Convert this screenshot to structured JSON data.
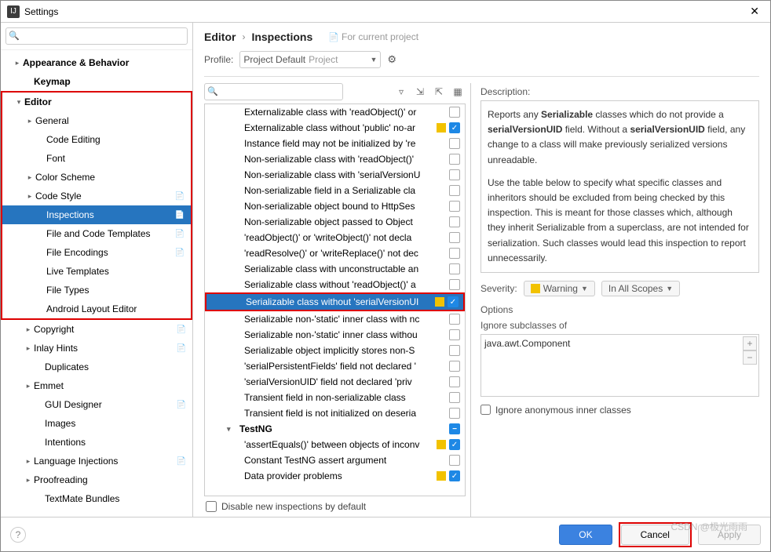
{
  "window": {
    "title": "Settings"
  },
  "sidebar_search": {
    "placeholder": ""
  },
  "tree": [
    {
      "label": "Appearance & Behavior",
      "indent": 14,
      "arrow": "▸",
      "bold": true
    },
    {
      "label": "Keymap",
      "indent": 28,
      "arrow": "",
      "bold": true
    },
    {
      "label": "Editor",
      "indent": 14,
      "arrow": "▾",
      "bold": true,
      "redstart": true
    },
    {
      "label": "General",
      "indent": 28,
      "arrow": "▸"
    },
    {
      "label": "Code Editing",
      "indent": 42,
      "arrow": ""
    },
    {
      "label": "Font",
      "indent": 42,
      "arrow": ""
    },
    {
      "label": "Color Scheme",
      "indent": 28,
      "arrow": "▸"
    },
    {
      "label": "Code Style",
      "indent": 28,
      "arrow": "▸",
      "doc": true
    },
    {
      "label": "Inspections",
      "indent": 42,
      "arrow": "",
      "doc": true,
      "selected": true
    },
    {
      "label": "File and Code Templates",
      "indent": 42,
      "arrow": "",
      "doc": true
    },
    {
      "label": "File Encodings",
      "indent": 42,
      "arrow": "",
      "doc": true
    },
    {
      "label": "Live Templates",
      "indent": 42,
      "arrow": ""
    },
    {
      "label": "File Types",
      "indent": 42,
      "arrow": ""
    },
    {
      "label": "Android Layout Editor",
      "indent": 42,
      "arrow": "",
      "redend": true
    },
    {
      "label": "Copyright",
      "indent": 28,
      "arrow": "▸",
      "doc": true
    },
    {
      "label": "Inlay Hints",
      "indent": 28,
      "arrow": "▸",
      "doc": true
    },
    {
      "label": "Duplicates",
      "indent": 42,
      "arrow": ""
    },
    {
      "label": "Emmet",
      "indent": 28,
      "arrow": "▸"
    },
    {
      "label": "GUI Designer",
      "indent": 42,
      "arrow": "",
      "doc": true
    },
    {
      "label": "Images",
      "indent": 42,
      "arrow": ""
    },
    {
      "label": "Intentions",
      "indent": 42,
      "arrow": ""
    },
    {
      "label": "Language Injections",
      "indent": 28,
      "arrow": "▸",
      "doc": true
    },
    {
      "label": "Proofreading",
      "indent": 28,
      "arrow": "▸"
    },
    {
      "label": "TextMate Bundles",
      "indent": 42,
      "arrow": ""
    }
  ],
  "breadcrumb": {
    "a": "Editor",
    "b": "Inspections",
    "hint": "For current project"
  },
  "profile": {
    "label": "Profile:",
    "value": "Project Default",
    "suffix": "Project"
  },
  "inspections": [
    {
      "txt": "Externalizable class with 'readObject()' or",
      "badge": "",
      "cb": "off"
    },
    {
      "txt": "Externalizable class without 'public' no-ar",
      "badge": "warn",
      "cb": "on"
    },
    {
      "txt": "Instance field may not be initialized by 're",
      "badge": "",
      "cb": "off"
    },
    {
      "txt": "Non-serializable class with 'readObject()'",
      "badge": "",
      "cb": "off"
    },
    {
      "txt": "Non-serializable class with 'serialVersionU",
      "badge": "",
      "cb": "off"
    },
    {
      "txt": "Non-serializable field in a Serializable cla",
      "badge": "",
      "cb": "off"
    },
    {
      "txt": "Non-serializable object bound to HttpSes",
      "badge": "",
      "cb": "off"
    },
    {
      "txt": "Non-serializable object passed to Object",
      "badge": "",
      "cb": "off"
    },
    {
      "txt": "'readObject()' or 'writeObject()' not decla",
      "badge": "",
      "cb": "off"
    },
    {
      "txt": "'readResolve()' or 'writeReplace()' not dec",
      "badge": "",
      "cb": "off"
    },
    {
      "txt": "Serializable class with unconstructable an",
      "badge": "",
      "cb": "off"
    },
    {
      "txt": "Serializable class without 'readObject()' a",
      "badge": "",
      "cb": "off"
    },
    {
      "txt": "Serializable class without 'serialVersionUI",
      "badge": "warn",
      "cb": "on",
      "selected": true,
      "red": true
    },
    {
      "txt": "Serializable non-'static' inner class with nc",
      "badge": "",
      "cb": "off"
    },
    {
      "txt": "Serializable non-'static' inner class withou",
      "badge": "",
      "cb": "off"
    },
    {
      "txt": "Serializable object implicitly stores non-S",
      "badge": "",
      "cb": "off"
    },
    {
      "txt": "'serialPersistentFields' field not declared '",
      "badge": "",
      "cb": "off"
    },
    {
      "txt": "'serialVersionUID' field not declared 'priv",
      "badge": "",
      "cb": "off"
    },
    {
      "txt": "Transient field in non-serializable class",
      "badge": "",
      "cb": "off"
    },
    {
      "txt": "Transient field is not initialized on deseria",
      "badge": "",
      "cb": "off"
    },
    {
      "txt": "TestNG",
      "group": true,
      "cb": "minus"
    },
    {
      "txt": "'assertEquals()' between objects of inconv",
      "badge": "warn",
      "cb": "on"
    },
    {
      "txt": "Constant TestNG assert argument",
      "badge": "",
      "cb": "off"
    },
    {
      "txt": "Data provider problems",
      "badge": "warn",
      "cb": "on"
    }
  ],
  "disable_label": "Disable new inspections by default",
  "desc": {
    "title": "Description:",
    "p1a": "Reports any ",
    "p1b": "Serializable",
    "p1c": " classes which do not provide a ",
    "p1d": "serialVersionUID",
    "p1e": " field. Without a ",
    "p1f": "serialVersionUID",
    "p1g": " field, any change to a class will make previously serialized versions unreadable.",
    "p2": "Use the table below to specify what specific classes and inheritors should be excluded from being checked by this inspection. This is meant for those classes which, although they inherit Serializable from a superclass, are not intended for serialization. Such classes would lead this inspection to report unnecessarily."
  },
  "severity": {
    "label": "Severity:",
    "value": "Warning",
    "scope": "In All Scopes"
  },
  "options": {
    "title": "Options",
    "sub_label": "Ignore subclasses of",
    "item": "java.awt.Component",
    "anon": "Ignore anonymous inner classes"
  },
  "footer": {
    "ok": "OK",
    "cancel": "Cancel",
    "apply": "Apply"
  },
  "watermark": "CSDN @极光雨雨"
}
